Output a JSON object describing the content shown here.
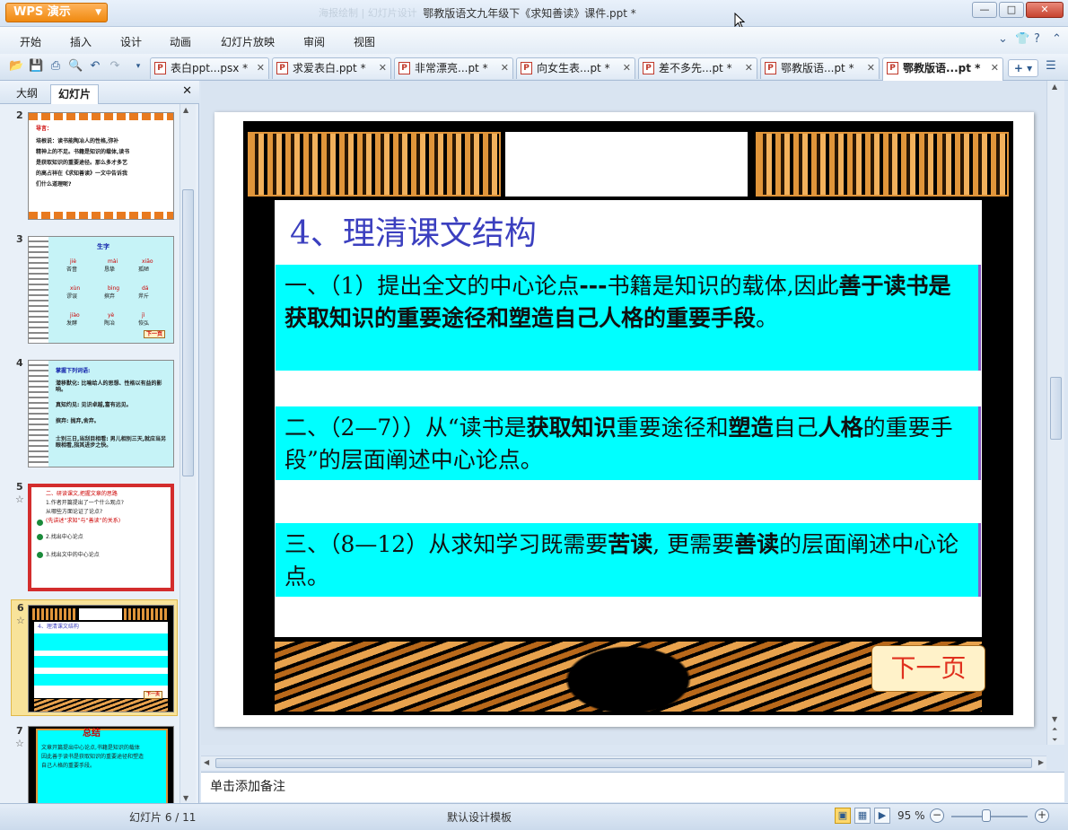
{
  "app": {
    "name": "WPS 演示"
  },
  "window": {
    "title": "鄂教版语文九年级下《求知善读》课件.ppt *",
    "ghost_text": "海报绘制 | 幻灯片设计",
    "controls": [
      "minimize",
      "maximize",
      "close"
    ]
  },
  "menu": {
    "items": [
      "开始",
      "插入",
      "设计",
      "动画",
      "幻灯片放映",
      "审阅",
      "视图"
    ]
  },
  "tabs": [
    {
      "label": "表白ppt...psx *",
      "active": false
    },
    {
      "label": "求爱表白.ppt *",
      "active": false
    },
    {
      "label": "非常漂亮...pt *",
      "active": false
    },
    {
      "label": "向女生表...pt *",
      "active": false
    },
    {
      "label": "差不多先...pt *",
      "active": false
    },
    {
      "label": "鄂教版语...pt *",
      "active": false
    },
    {
      "label": "鄂教版语...pt *",
      "active": true
    }
  ],
  "left_pane": {
    "tabs": [
      "大纲",
      "幻灯片"
    ],
    "active_tab": "幻灯片",
    "thumbs": [
      {
        "num": "2",
        "has_anim": false,
        "lines": [
          "导言：",
          "培根说：读书能陶冶人的性格,弥补",
          "精神上的不足。书籍是知识的载体,读书",
          "是获取知识的重要途径。那么多才多艺",
          "的高占祥在《求知善读》一文中告诉我",
          "们什么道理呢?"
        ]
      },
      {
        "num": "3",
        "has_anim": false,
        "title": "生字",
        "pinyin": [
          "jiè",
          "mài",
          "xiāo",
          "xùn",
          "bìng",
          "dá",
          "jiào",
          "yè",
          "jì"
        ],
        "words": [
          "吝啬",
          "恳挚",
          "孤陋",
          "谬误",
          "摈弃",
          "斧斤",
          "发酵",
          "陶冶",
          "恢弘"
        ],
        "button": "下一页"
      },
      {
        "num": "4",
        "has_anim": false,
        "lines": [
          "掌握下列词语:",
          "潜移默化: 比喻给人的思想、性格以有益的影响。",
          "真知灼见: 见识卓越,富有远见。",
          "摈弃: 抛弃,舍弃。",
          "士别三日,当刮目相看: 男儿相别三天,就应当另眼相看,指其进步之快。"
        ]
      },
      {
        "num": "5",
        "has_anim": true,
        "lines": [
          "二、研读课文,把握文章的思路",
          "1.作者开篇提出了一个什么观点?",
          "从哪些方面论证了论点?",
          "(先讲述“求知”与“善读”的关系)",
          "2.找出中心论点",
          "3.找出文中的中心论点"
        ]
      },
      {
        "num": "6",
        "has_anim": true,
        "lines": [
          "4、理清课文结构"
        ],
        "button": "下一页"
      },
      {
        "num": "7",
        "has_anim": true,
        "title": "总结",
        "lines": [
          "文章开篇提出中心论点,书籍是知识的载体",
          "因此善于读书是获取知识的重要途径和塑造",
          "自己人格的重要手段。"
        ]
      }
    ]
  },
  "slide": {
    "heading": "4、理清课文结构",
    "points": [
      [
        {
          "t": "一、（1）提出全文的中心论点",
          "b": false
        },
        {
          "t": "---",
          "b": true
        },
        {
          "t": "书籍是知识的载体,因此",
          "b": false
        },
        {
          "t": "善于读书是获取知识的重要途径和塑造自己人格的重要手段",
          "b": true
        },
        {
          "t": "。",
          "b": false
        }
      ],
      [
        {
          "t": "二、（2—7））从“读书是",
          "b": false
        },
        {
          "t": "获取知识",
          "b": true
        },
        {
          "t": "重要途径和",
          "b": false
        },
        {
          "t": "塑造",
          "b": true
        },
        {
          "t": "自己",
          "b": false
        },
        {
          "t": "人格",
          "b": true
        },
        {
          "t": "的重要手段”的层面阐述中心论点。",
          "b": false
        }
      ],
      [
        {
          "t": "三、（8—12）从求知学习既需要",
          "b": false
        },
        {
          "t": "苦读",
          "b": true
        },
        {
          "t": ", 更需要",
          "b": false
        },
        {
          "t": "善读",
          "b": true
        },
        {
          "t": "的层面阐述中心论点。",
          "b": false
        }
      ]
    ],
    "next_button": "下一页"
  },
  "notes": {
    "placeholder": "单击添加备注"
  },
  "status": {
    "slide_counter": "幻灯片 6 / 11",
    "template": "默认设计模板",
    "zoom": "95 %",
    "zoom_level_percent": 95
  },
  "colors": {
    "accent_orange": "#f08a10",
    "slide_cyan": "#00ffff",
    "heading_blue": "#3b3fbf",
    "next_red": "#e0301e"
  }
}
